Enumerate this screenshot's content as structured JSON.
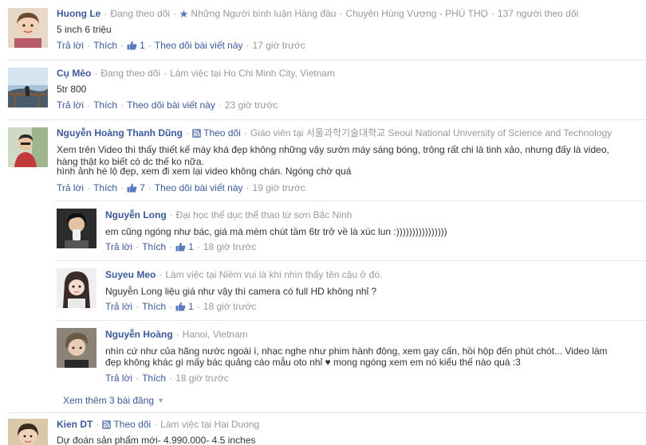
{
  "comments": [
    {
      "name": "Huong Le",
      "follow": "Đang theo dõi",
      "badge": "Những Người bình luận Hàng đầu",
      "location": "Chuyên Hùng Vương - PHÚ THỌ",
      "followers": "137 người theo dõi",
      "text": "5 inch 6 triệu",
      "reply": "Trả lời",
      "like": "Thích",
      "likes": "1",
      "follow_post": "Theo dõi bài viết này",
      "time": "17 giờ trước"
    },
    {
      "name": "Cụ Mèo",
      "follow": "Đang theo dõi",
      "meta": "Làm việc tại Ho Chi Minh City, Vietnam",
      "text": "5tr 800",
      "reply": "Trả lời",
      "like": "Thích",
      "follow_post": "Theo dõi bài viết này",
      "time": "23 giờ trước"
    },
    {
      "name": "Nguyễn Hoàng Thanh Dũng",
      "follow": "Theo dõi",
      "meta": "Giáo viên tại 서울과학기술대학교 Seoul National University of Science and Technology",
      "text1": "Xem trên Video thì thấy thiết kế máy khá đẹp không những vậy sườn máy sáng bóng, trông rất chi là tinh xảo, nhưng đấy là video,",
      "text2": "hàng thật ko biết có dc thế ko nữa.",
      "text3": "hình ảnh hé lộ đẹp, xem đi xem lại video không chán. Ngóng chờ quá",
      "reply": "Trả lời",
      "like": "Thích",
      "likes": "7",
      "follow_post": "Theo dõi bài viết này",
      "time": "19 giờ trước"
    },
    {
      "name": "Kien DT",
      "follow": "Theo dõi",
      "meta": "Làm việc tại Hai Duong",
      "text": "Dự đoán sản phẩm mới- 4.990.000- 4.5 inches"
    }
  ],
  "replies": [
    {
      "name": "Nguyễn Long",
      "meta": "Đại học thể dục thể thao từ sơn Bắc Ninh",
      "text": "em cũng ngóng như bác, giá mà mèm chút tầm 6tr trở về là xúc lun :))))))))))))))))",
      "reply": "Trả lời",
      "like": "Thích",
      "likes": "1",
      "time": "18 giờ trước"
    },
    {
      "name": "Suyeu Meo",
      "meta": "Làm việc tại Niềm vui là khi nhìn thấy tên cậu ở đó.",
      "text": "Nguyễn Long liệu giá như vậy thì camera có full HD không nhỉ ?",
      "reply": "Trả lời",
      "like": "Thích",
      "likes": "1",
      "time": "18 giờ trước"
    },
    {
      "name": "Nguyễn Hoàng",
      "meta": "Hanoi, Vietnam",
      "text1": "nhìn cứ như của hãng nước ngoài í, nhạc nghe như phim hành động, xem gay cấn, hồi hộp đến phút chót... Video làm",
      "text2": "đẹp không khác gì mấy bác quảng cáo mẫu oto nhỉ ♥ mong ngóng xem em nó kiểu thế nào quá :3",
      "reply": "Trả lời",
      "like": "Thích",
      "time": "18 giờ trước"
    }
  ],
  "more_replies": "Xem thêm 3 bài đăng",
  "colors": {
    "link": "#3b5998",
    "meta": "#999999",
    "text": "#333333"
  }
}
